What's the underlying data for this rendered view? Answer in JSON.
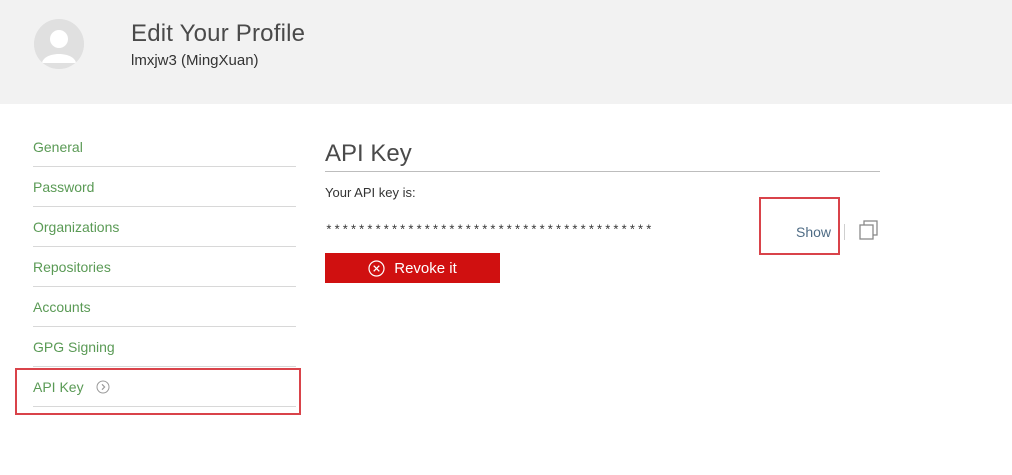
{
  "header": {
    "title": "Edit Your Profile",
    "subtitle": "lmxjw3 (MingXuan)",
    "avatar_icon": "user-avatar-icon"
  },
  "sidebar": {
    "items": [
      {
        "label": "General"
      },
      {
        "label": "Password"
      },
      {
        "label": "Organizations"
      },
      {
        "label": "Repositories"
      },
      {
        "label": "Accounts"
      },
      {
        "label": "GPG Signing"
      },
      {
        "label": "API Key",
        "active": true,
        "icon": "chevron-right-circle-icon"
      }
    ],
    "link_color": "#5a9a55"
  },
  "main": {
    "section_title": "API Key",
    "api_label": "Your API key is:",
    "api_key_masked": "****************************************",
    "show_label": "Show",
    "copy_icon": "copy-icon",
    "revoke_label": "Revoke it",
    "revoke_color": "#d01010"
  },
  "annotations": {
    "highlight_color": "#d9434a"
  }
}
